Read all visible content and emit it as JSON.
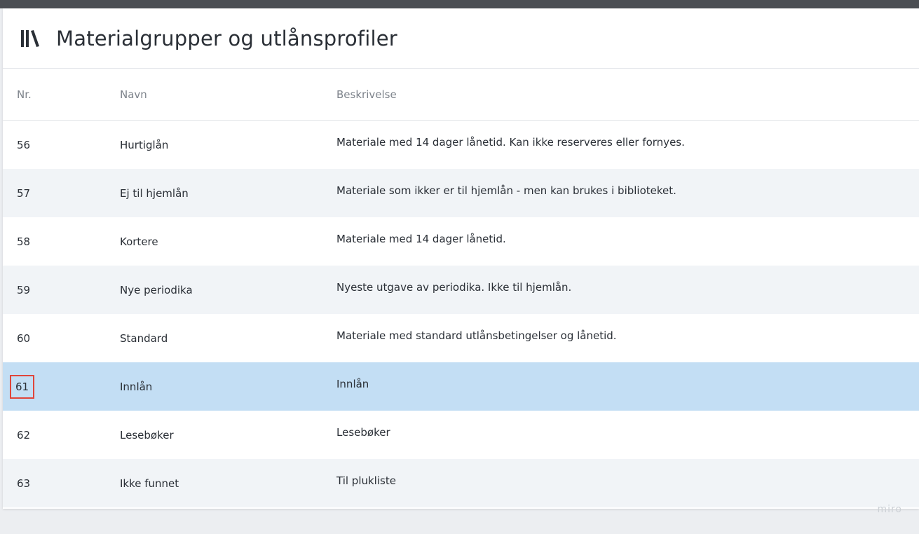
{
  "header": {
    "title": "Materialgrupper og utlånsprofiler",
    "icon": "library-books-icon"
  },
  "table": {
    "columns": {
      "nr": "Nr.",
      "name": "Navn",
      "description": "Beskrivelse"
    },
    "rows": [
      {
        "nr": "56",
        "name": "Hurtiglån",
        "description": "Materiale med 14 dager lånetid. Kan ikke reserveres eller fornyes."
      },
      {
        "nr": "57",
        "name": "Ej til hjemlån",
        "description": "Materiale som ikker er til hjemlån - men kan brukes i biblioteket."
      },
      {
        "nr": "58",
        "name": "Kortere",
        "description": "Materiale med 14 dager lånetid."
      },
      {
        "nr": "59",
        "name": "Nye periodika",
        "description": "Nyeste utgave av periodika. Ikke til hjemlån."
      },
      {
        "nr": "60",
        "name": "Standard",
        "description": "Materiale med standard utlånsbetingelser og lånetid."
      },
      {
        "nr": "61",
        "name": "Innlån",
        "description": "Innlån"
      },
      {
        "nr": "62",
        "name": "Lesebøker",
        "description": "Lesebøker"
      },
      {
        "nr": "63",
        "name": "Ikke funnet",
        "description": "Til plukliste"
      }
    ],
    "selected_row_nr": "61"
  },
  "colors": {
    "selected_row": "#c3def4",
    "alt_row": "#f1f4f7",
    "highlight_box": "#e0453a",
    "top_bar": "#4b4e53"
  },
  "watermark": "miro"
}
